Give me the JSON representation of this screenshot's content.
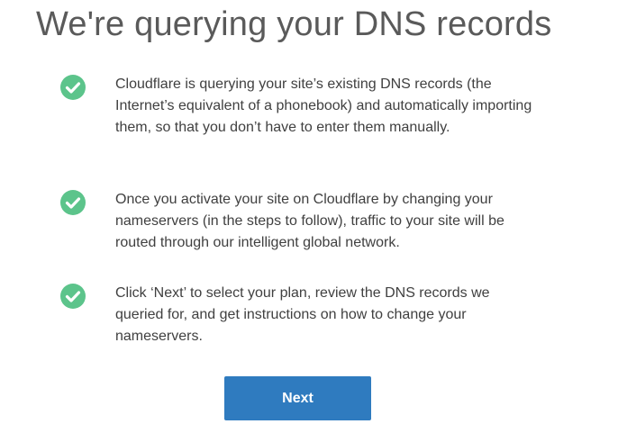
{
  "header": {
    "title": "We're querying your DNS records"
  },
  "steps": [
    {
      "icon": "check-circle-icon",
      "text": "Cloudflare is querying your site’s existing DNS records (the Internet’s equivalent of a phonebook) and automatically importing them, so that you don’t have to enter them manually."
    },
    {
      "icon": "check-circle-icon",
      "text": "Once you activate your site on Cloudflare by changing your nameservers (in the steps to follow), traffic to your site will be routed through our intelligent global network."
    },
    {
      "icon": "check-circle-icon",
      "text": "Click ‘Next’ to select your plan, review the DNS records we queried for, and get instructions on how to change your nameservers."
    }
  ],
  "actions": {
    "next_label": "Next"
  },
  "colors": {
    "check": "#5cc48b",
    "button": "#2f7bbf",
    "title": "#5a5a5a",
    "text": "#404040"
  }
}
